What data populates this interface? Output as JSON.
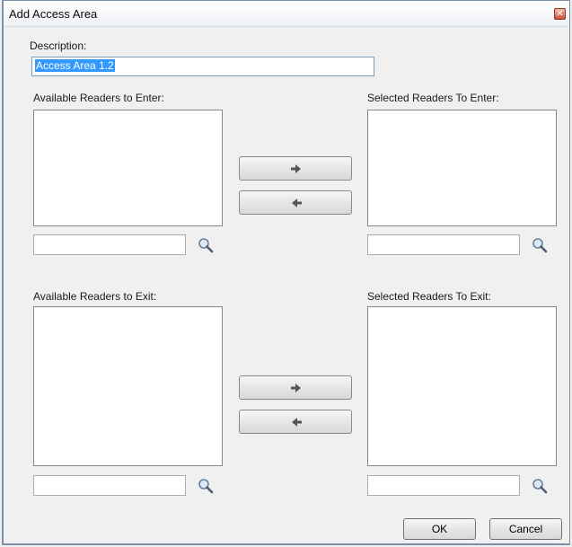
{
  "window": {
    "title": "Add Access Area",
    "close_icon": "close-icon"
  },
  "description": {
    "label": "Description:",
    "value": "Access Area 1.2"
  },
  "enter": {
    "available_label": "Available Readers to Enter:",
    "selected_label": "Selected Readers To Enter:",
    "available_search_value": "",
    "selected_search_value": ""
  },
  "exit": {
    "available_label": "Available Readers to Exit:",
    "selected_label": "Selected Readers To Exit:",
    "available_search_value": "",
    "selected_search_value": ""
  },
  "buttons": {
    "ok_label": "OK",
    "cancel_label": "Cancel"
  },
  "icons": {
    "search": "search-icon",
    "move_right": "arrow-right-icon",
    "move_left": "arrow-left-icon"
  },
  "colors": {
    "selection": "#3399ff",
    "title_bar": "#eef1f5",
    "dialog_bg": "#f0f0f0"
  }
}
